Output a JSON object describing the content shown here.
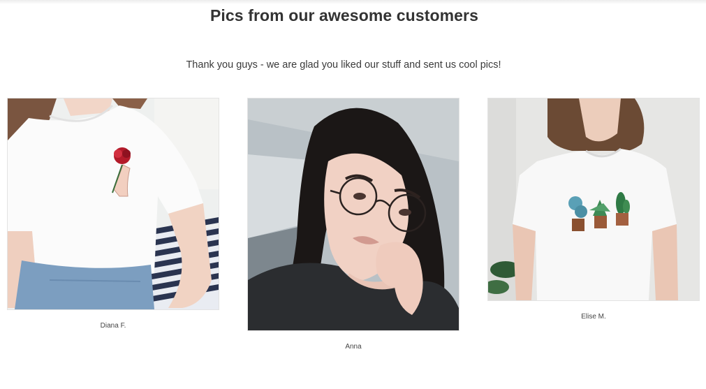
{
  "header": {
    "title": "Pics from our awesome customers",
    "subtitle": "Thank you guys - we are glad you liked our stuff and sent us cool pics!"
  },
  "gallery": {
    "items": [
      {
        "name": "Diana F.",
        "image": "customer photo - white t-shirt with embroidered rose"
      },
      {
        "name": "Anna",
        "image": "customer photo - selfie with round glasses"
      },
      {
        "name": "Elise M.",
        "image": "customer photo - white t-shirt with embroidered cacti"
      }
    ]
  }
}
